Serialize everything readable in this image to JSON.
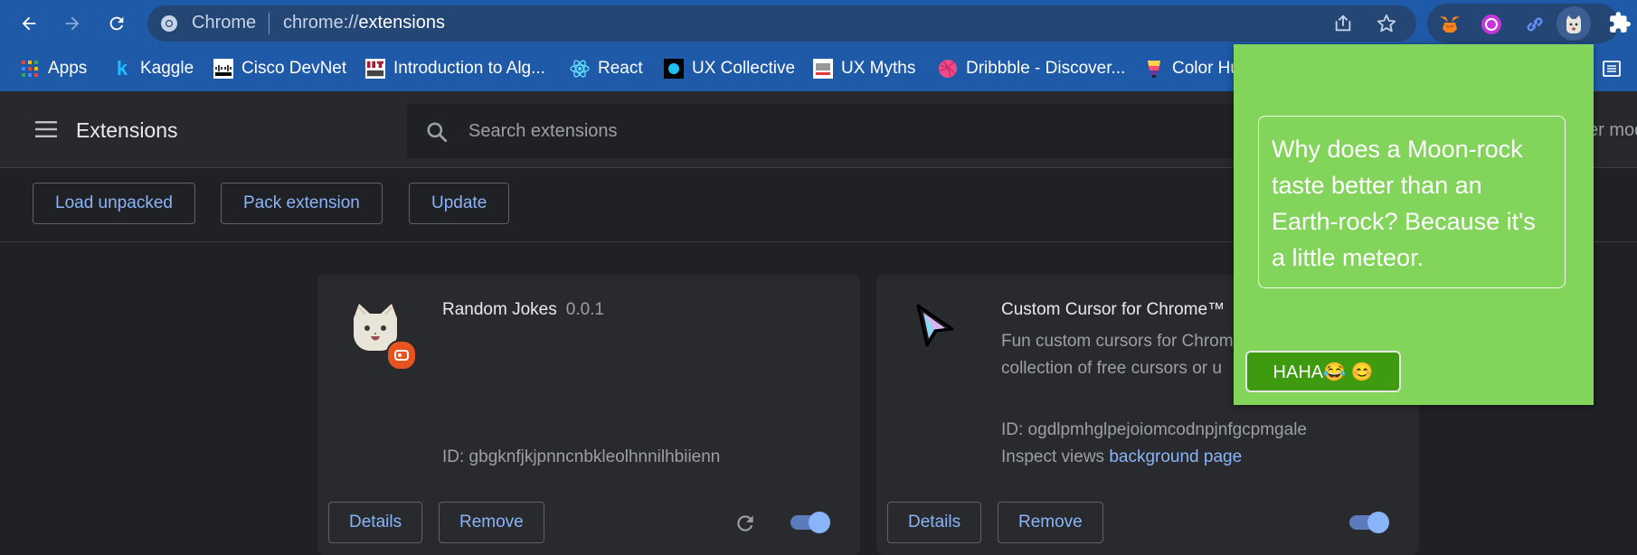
{
  "browser": {
    "omnibox_host": "Chrome",
    "omnibox_scheme": "chrome://",
    "omnibox_path": "extensions"
  },
  "bookmarks": [
    {
      "label": "Apps",
      "icon": "apps-grid-icon"
    },
    {
      "label": "Kaggle",
      "icon": "kaggle-icon"
    },
    {
      "label": "Cisco DevNet",
      "icon": "cisco-icon"
    },
    {
      "label": "Introduction to Alg...",
      "icon": "mit-ocw-icon"
    },
    {
      "label": "React",
      "icon": "react-icon"
    },
    {
      "label": "UX Collective",
      "icon": "ux-collective-icon"
    },
    {
      "label": "UX Myths",
      "icon": "ux-myths-icon"
    },
    {
      "label": "Dribbble - Discover...",
      "icon": "dribbble-icon"
    },
    {
      "label": "Color Hu",
      "icon": "color-hunt-icon"
    }
  ],
  "header": {
    "title": "Extensions",
    "search_placeholder": "Search extensions",
    "devmode_label": "er mod"
  },
  "toolbar": {
    "load_unpacked": "Load unpacked",
    "pack_extension": "Pack extension",
    "update": "Update"
  },
  "cards": [
    {
      "name": "Random Jokes",
      "version": "0.0.1",
      "id_line": "ID: gbgknfjkjpnncnbkleolhnnilhbiienn",
      "details": "Details",
      "remove": "Remove",
      "enabled": true
    },
    {
      "name": "Custom Cursor for Chrome™",
      "desc_line1": "Fun custom cursors for Chrom",
      "desc_line2": "collection of free cursors or u",
      "id_line": "ID: ogdlpmhglpejoiomcodnpjnfgcpmgale",
      "inspect_label": "Inspect views",
      "inspect_link": "background page",
      "details": "Details",
      "remove": "Remove",
      "enabled": true
    }
  ],
  "popup": {
    "joke": "Why does a Moon-rock taste better than an Earth-rock? Because it's a little meteor.",
    "button": "HAHA😂 😊"
  },
  "colors": {
    "topbar": "#1e5aa8",
    "popup_bg": "#82d45b",
    "popup_button": "#3e9a0f",
    "link": "#8ab4f8"
  }
}
